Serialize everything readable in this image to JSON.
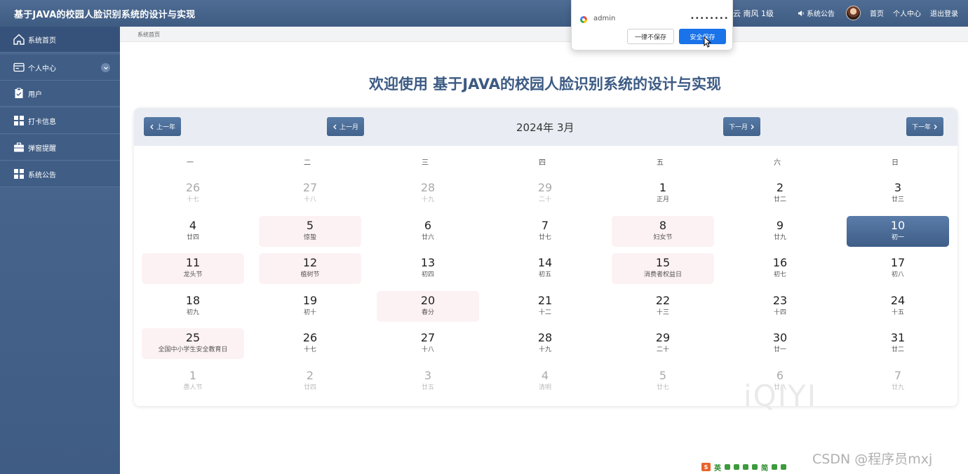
{
  "header": {
    "app_title": "基于JAVA的校园人脸识别系统的设计与实现",
    "user_info": "云 南风  1级",
    "notice_label": "系统公告",
    "nav_home": "首页",
    "nav_profile": "个人中心",
    "nav_logout": "退出登录"
  },
  "sidebar": {
    "items": [
      {
        "label": "系统首页",
        "icon": "home-icon"
      },
      {
        "label": "个人中心",
        "icon": "wallet-icon"
      },
      {
        "label": "用户",
        "icon": "clipboard-icon"
      },
      {
        "label": "打卡信息",
        "icon": "grid-icon"
      },
      {
        "label": "弹窗提醒",
        "icon": "briefcase-icon"
      },
      {
        "label": "系统公告",
        "icon": "grid-icon"
      }
    ]
  },
  "breadcrumb": "系统首页",
  "welcome": "欢迎使用 基于JAVA的校园人脸识别系统的设计与实现",
  "calendar": {
    "title": "2024年 3月",
    "prev_year": "上一年",
    "prev_month": "上一月",
    "next_month": "下一月",
    "next_year": "下一年",
    "weekdays": [
      "一",
      "二",
      "三",
      "四",
      "五",
      "六",
      "日"
    ],
    "days": [
      {
        "num": "26",
        "lunar": "十七",
        "other": true
      },
      {
        "num": "27",
        "lunar": "十八",
        "other": true
      },
      {
        "num": "28",
        "lunar": "十九",
        "other": true
      },
      {
        "num": "29",
        "lunar": "二十",
        "other": true
      },
      {
        "num": "1",
        "lunar": "正月"
      },
      {
        "num": "2",
        "lunar": "廿二"
      },
      {
        "num": "3",
        "lunar": "廿三"
      },
      {
        "num": "4",
        "lunar": "廿四"
      },
      {
        "num": "5",
        "lunar": "惊蛰",
        "festival": true
      },
      {
        "num": "6",
        "lunar": "廿六"
      },
      {
        "num": "7",
        "lunar": "廿七"
      },
      {
        "num": "8",
        "lunar": "妇女节",
        "festival": true
      },
      {
        "num": "9",
        "lunar": "廿九"
      },
      {
        "num": "10",
        "lunar": "初一",
        "today": true
      },
      {
        "num": "11",
        "lunar": "龙头节",
        "festival": true
      },
      {
        "num": "12",
        "lunar": "植树节",
        "festival": true
      },
      {
        "num": "13",
        "lunar": "初四"
      },
      {
        "num": "14",
        "lunar": "初五"
      },
      {
        "num": "15",
        "lunar": "消费者权益日",
        "festival": true
      },
      {
        "num": "16",
        "lunar": "初七"
      },
      {
        "num": "17",
        "lunar": "初八"
      },
      {
        "num": "18",
        "lunar": "初九"
      },
      {
        "num": "19",
        "lunar": "初十"
      },
      {
        "num": "20",
        "lunar": "春分",
        "festival": true
      },
      {
        "num": "21",
        "lunar": "十二"
      },
      {
        "num": "22",
        "lunar": "十三"
      },
      {
        "num": "23",
        "lunar": "十四"
      },
      {
        "num": "24",
        "lunar": "十五"
      },
      {
        "num": "25",
        "lunar": "全国中小学生安全教育日",
        "festival": true
      },
      {
        "num": "26",
        "lunar": "十七"
      },
      {
        "num": "27",
        "lunar": "十八"
      },
      {
        "num": "28",
        "lunar": "十九"
      },
      {
        "num": "29",
        "lunar": "二十"
      },
      {
        "num": "30",
        "lunar": "廿一"
      },
      {
        "num": "31",
        "lunar": "廿二"
      },
      {
        "num": "1",
        "lunar": "愚人节",
        "other": true
      },
      {
        "num": "2",
        "lunar": "廿四",
        "other": true
      },
      {
        "num": "3",
        "lunar": "廿五",
        "other": true
      },
      {
        "num": "4",
        "lunar": "清明",
        "other": true
      },
      {
        "num": "5",
        "lunar": "廿七",
        "other": true
      },
      {
        "num": "6",
        "lunar": "廿八",
        "other": true
      },
      {
        "num": "7",
        "lunar": "廿九",
        "other": true
      }
    ]
  },
  "password_popup": {
    "username": "admin",
    "password_mask": "••••••••",
    "never_label": "一律不保存",
    "save_label": "安全保存"
  },
  "overlays": {
    "player_watermark": "iQIYI",
    "csdn_watermark": "CSDN @程序员mxj",
    "ime_lang": "英",
    "ime_mode": "简"
  },
  "colors": {
    "header_bg": "#4f6d94",
    "sidebar_bg": "#3f5d85",
    "accent": "#42638c",
    "festival_bg": "#fdf2f3",
    "save_button": "#1a73e8"
  }
}
